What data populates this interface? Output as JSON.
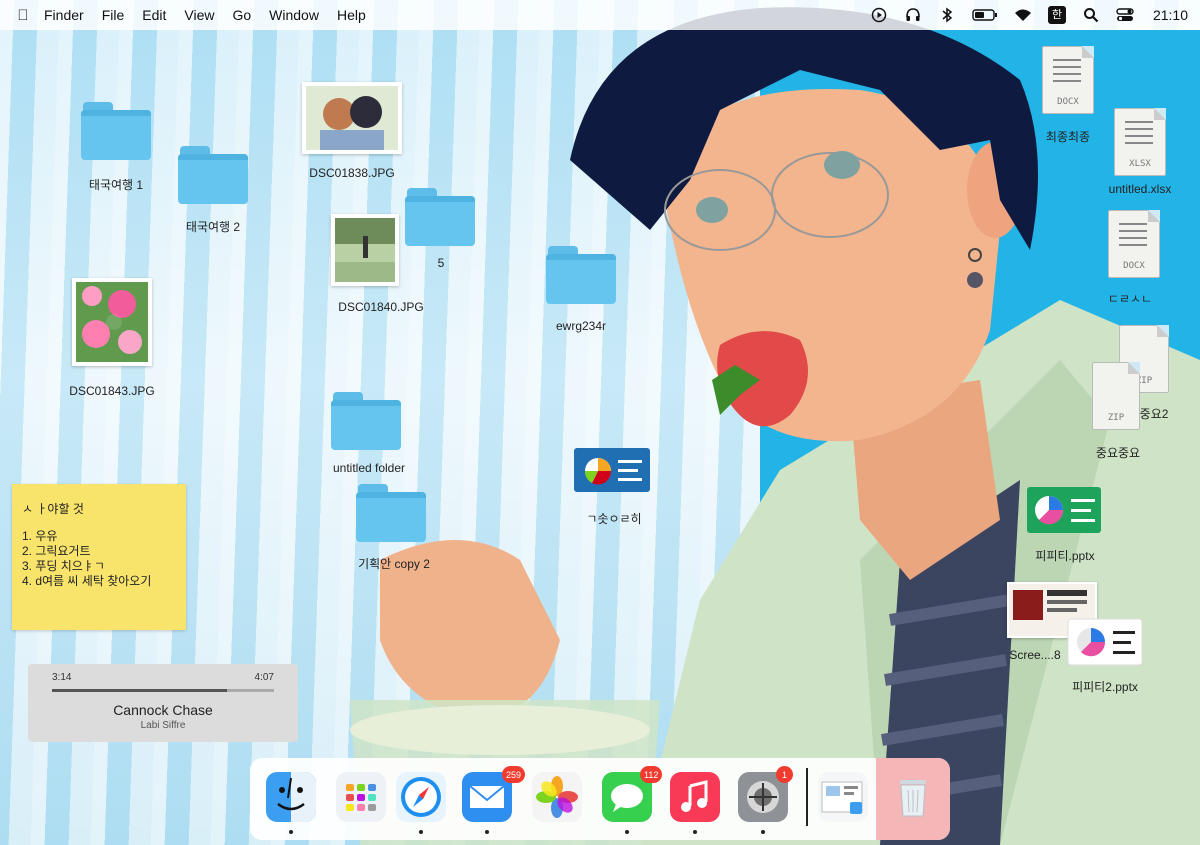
{
  "menubar": {
    "apple_icon": "apple-logo-icon",
    "menus": [
      "Finder",
      "File",
      "Edit",
      "View",
      "Go",
      "Window",
      "Help"
    ],
    "status_icons": [
      "play-icon",
      "headphones-icon",
      "bluetooth-icon",
      "battery-icon",
      "wifi-icon",
      "input-source-icon",
      "search-icon",
      "control-center-icon"
    ],
    "input_source": "한",
    "clock": "21:10"
  },
  "desktop": {
    "folders": {
      "f1": "태국여행 1",
      "f2": "태국여행 2",
      "f3": "5",
      "f4": "ewrg234r",
      "f5": "untitled folder",
      "f6": "기획안 copy 2"
    },
    "images": {
      "i1": "DSC01838.JPG",
      "i2": "DSC01840.JPG",
      "i3": "DSC01843.JPG",
      "i4": "Scree....8"
    },
    "files": {
      "doc1": "최종최종",
      "doc1_ext": "DOCX",
      "xlsx": "untitled.xlsx",
      "xlsx_ext": "XLSX",
      "doc2": "ㄷㄹㅅㄴ",
      "doc2_ext": "DOCX",
      "zip1": "중요중요2",
      "zip2": "중요중요",
      "zip_ext": "ZIP",
      "keynote": "ㄱ솟ㅇㄹ히",
      "pptx1": "피피티.pptx",
      "pptx2": "피피티2.pptx"
    }
  },
  "sticky": {
    "title": "ㅅ ㅏ야할 것",
    "items": [
      "1. 우유",
      "2. 그릭요거트",
      "3. 푸딩 치으ㅑㄱ",
      "4. d여름 씨 세탁 찾아오기"
    ]
  },
  "player": {
    "elapsed": "3:14",
    "duration": "4:07",
    "progress_fraction": 0.79,
    "song": "Cannock Chase",
    "artist": "Labi Siffre"
  },
  "dock": {
    "apps": [
      {
        "name": "finder-icon",
        "badge": "",
        "running": true
      },
      {
        "name": "launchpad-icon",
        "badge": "",
        "running": false
      },
      {
        "name": "safari-icon",
        "badge": "",
        "running": true
      },
      {
        "name": "mail-icon",
        "badge": "259",
        "running": true
      },
      {
        "name": "photos-icon",
        "badge": "",
        "running": false
      },
      {
        "name": "messages-icon",
        "badge": "112",
        "running": true
      },
      {
        "name": "music-icon",
        "badge": "",
        "running": true
      },
      {
        "name": "system-preferences-icon",
        "badge": "1",
        "running": true
      },
      {
        "name": "downloads-stack-icon",
        "badge": "",
        "running": false
      },
      {
        "name": "trash-icon",
        "badge": "",
        "running": false
      }
    ]
  },
  "colors": {
    "folder_blue": "#66c5ef",
    "wallpaper_blue": "#22b4e6",
    "sticky_yellow": "#f8e36b",
    "badge_red": "#f13b2f"
  }
}
